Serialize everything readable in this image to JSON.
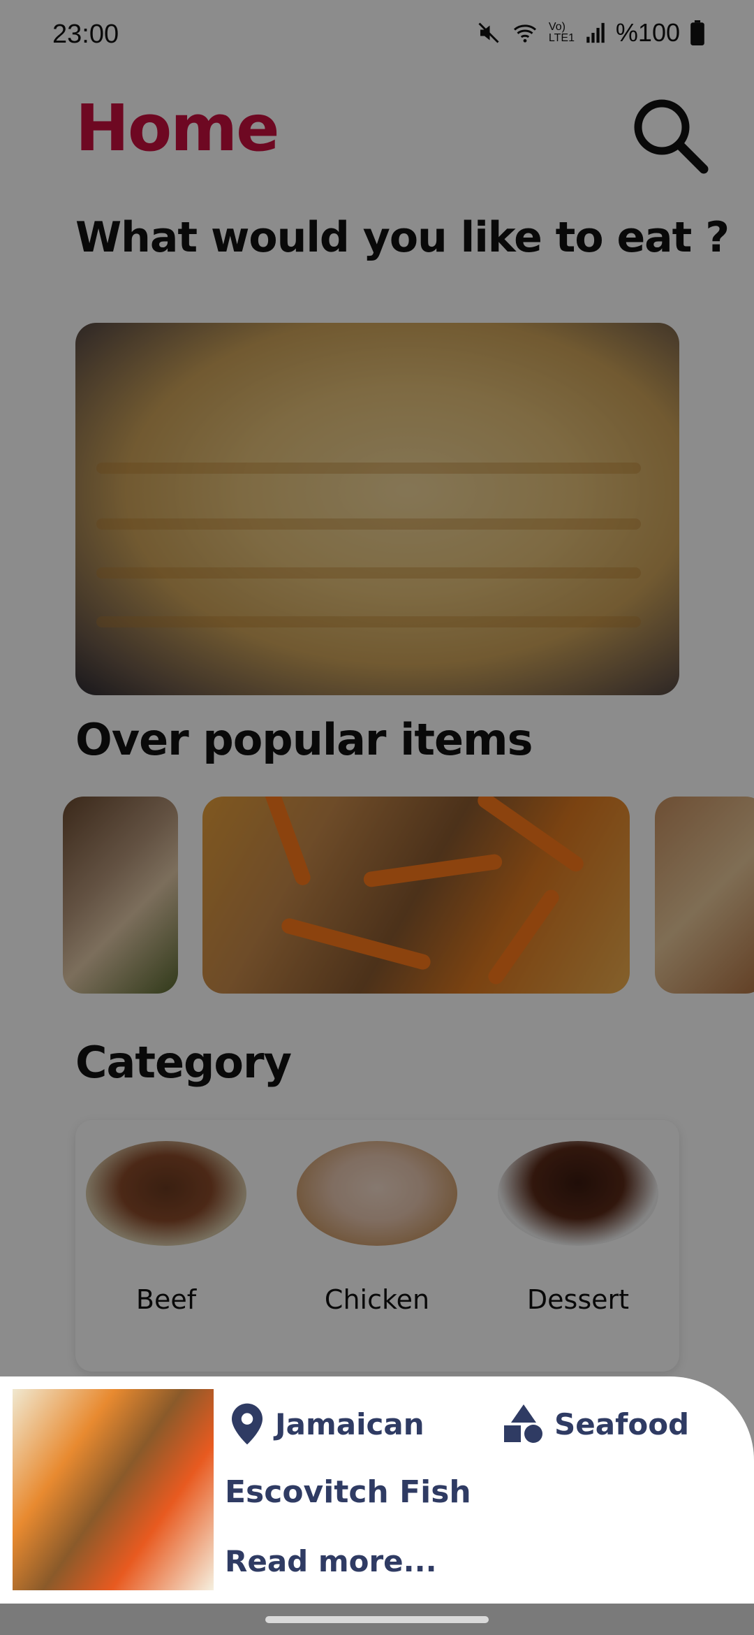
{
  "status_bar": {
    "time": "23:00",
    "battery": "%100",
    "network": "Vo) LTE1"
  },
  "header": {
    "title": "Home",
    "search_icon": "search-icon"
  },
  "prompt": "What would you like to eat ?",
  "sections": {
    "popular": "Over popular items",
    "category": "Category"
  },
  "categories": [
    {
      "label": "Beef"
    },
    {
      "label": "Chicken"
    },
    {
      "label": "Dessert"
    }
  ],
  "bottom_sheet": {
    "area": "Jamaican",
    "category": "Seafood",
    "meal_name": "Escovitch Fish",
    "read_more": "Read more..."
  },
  "colors": {
    "accent": "#c8103e",
    "sheet_text": "#2f3b63"
  }
}
